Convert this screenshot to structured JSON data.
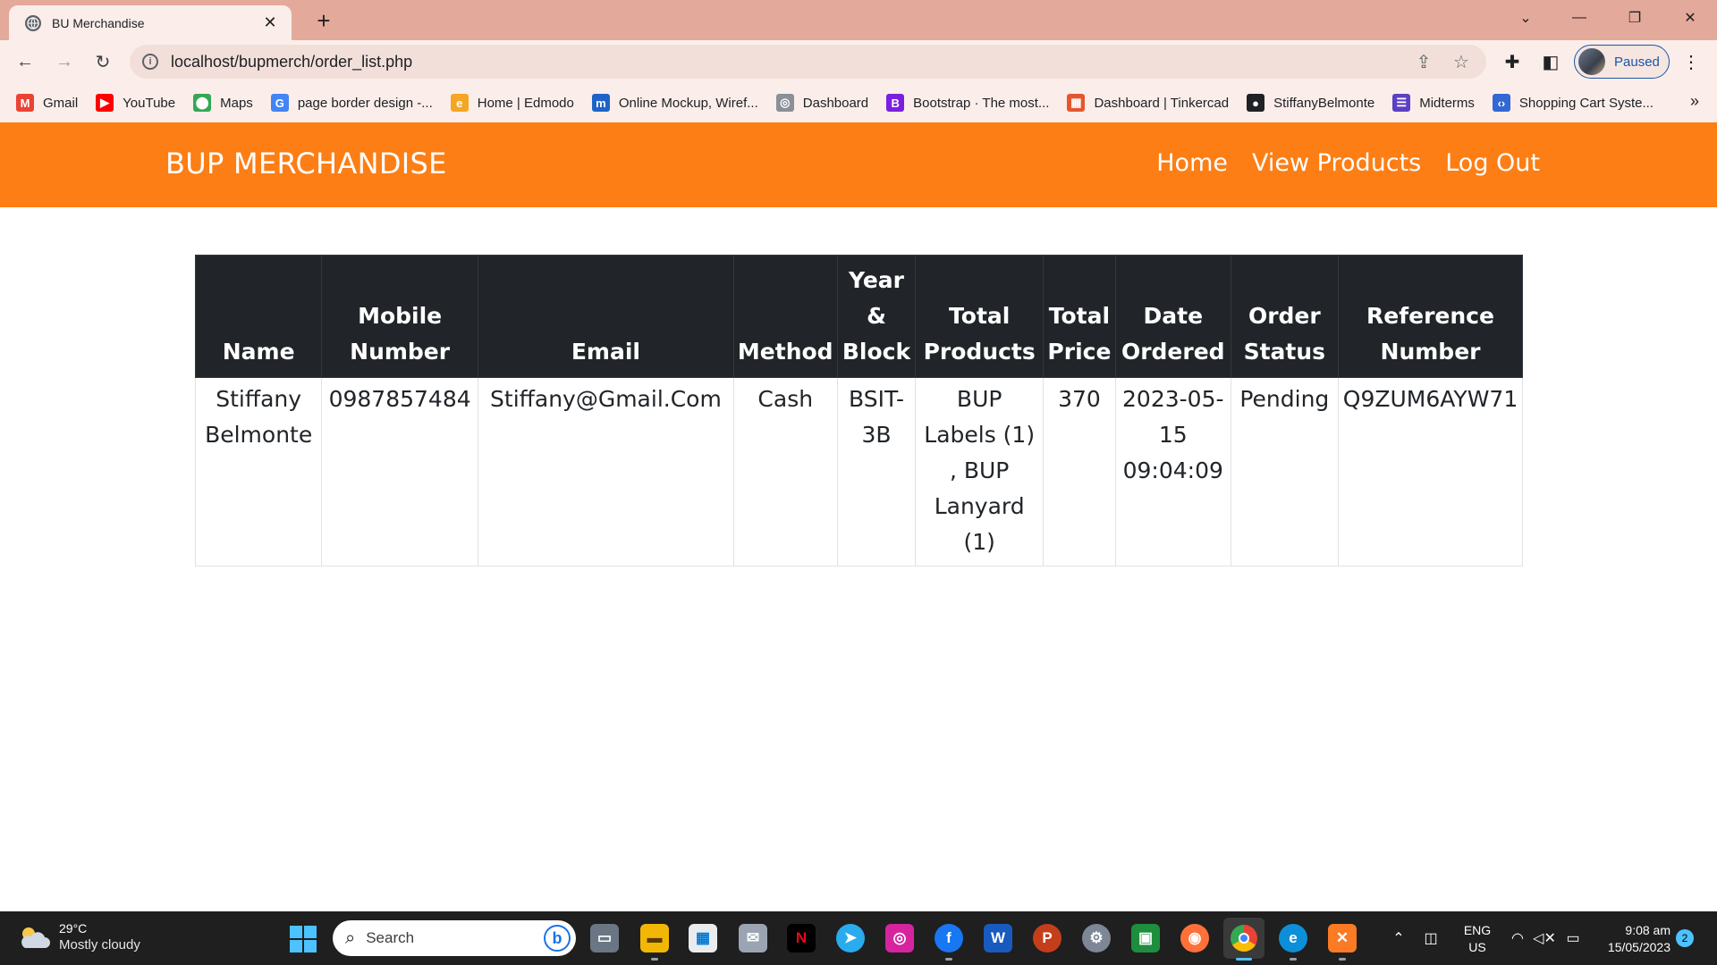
{
  "browser": {
    "tab_title": "BU Merchandise",
    "url": "localhost/bupmerch/order_list.php",
    "profile_status": "Paused",
    "bookmarks": [
      {
        "label": "Gmail",
        "icon": "gmail-icon",
        "color": "#ea4335",
        "glyph": "M"
      },
      {
        "label": "YouTube",
        "icon": "youtube-icon",
        "color": "#ff0000",
        "glyph": "▶"
      },
      {
        "label": "Maps",
        "icon": "maps-icon",
        "color": "#34a853",
        "glyph": "⬤"
      },
      {
        "label": "page border design -...",
        "icon": "google-icon",
        "color": "#4285f4",
        "glyph": "G"
      },
      {
        "label": "Home | Edmodo",
        "icon": "edmodo-icon",
        "color": "#f5a623",
        "glyph": "e"
      },
      {
        "label": "Online Mockup, Wiref...",
        "icon": "moqups-icon",
        "color": "#1e64c8",
        "glyph": "m"
      },
      {
        "label": "Dashboard",
        "icon": "dashboard-icon",
        "color": "#8a8f98",
        "glyph": "◎"
      },
      {
        "label": "Bootstrap · The most...",
        "icon": "bootstrap-icon",
        "color": "#7b1fe0",
        "glyph": "B"
      },
      {
        "label": "Dashboard | Tinkercad",
        "icon": "tinkercad-icon",
        "color": "#e4572e",
        "glyph": "▦"
      },
      {
        "label": "StiffanyBelmonte",
        "icon": "github-icon",
        "color": "#202124",
        "glyph": "●"
      },
      {
        "label": "Midterms",
        "icon": "midterms-icon",
        "color": "#5b3fc4",
        "glyph": "☰"
      },
      {
        "label": "Shopping Cart Syste...",
        "icon": "code-icon",
        "color": "#3367d6",
        "glyph": "‹›"
      }
    ]
  },
  "site": {
    "brand": "BUP MERCHANDISE",
    "nav": [
      "Home",
      "View Products",
      "Log Out"
    ]
  },
  "orders": {
    "headers": [
      "Name",
      "Mobile Number",
      "Email",
      "Method",
      "Year & Block",
      "Total Products",
      "Total Price",
      "Date Ordered",
      "Order Status",
      "Reference Number"
    ],
    "rows": [
      [
        "Stiffany Belmonte",
        "0987857484",
        "Stiffany@Gmail.Com",
        "Cash",
        "BSIT-3B",
        "BUP Labels (1) , BUP Lanyard (1)",
        "370",
        "2023-05-15 09:04:09",
        "Pending",
        "Q9ZUM6AYW71"
      ]
    ]
  },
  "taskbar": {
    "weather_temp": "29°C",
    "weather_cond": "Mostly cloudy",
    "search_placeholder": "Search",
    "lang_1": "ENG",
    "lang_2": "US",
    "time": "9:08 am",
    "date": "15/05/2023",
    "notifications": "2"
  },
  "colors": {
    "tab_strip": "#e3a99b",
    "navbar": "#fd7e14",
    "table_header": "#212529"
  }
}
